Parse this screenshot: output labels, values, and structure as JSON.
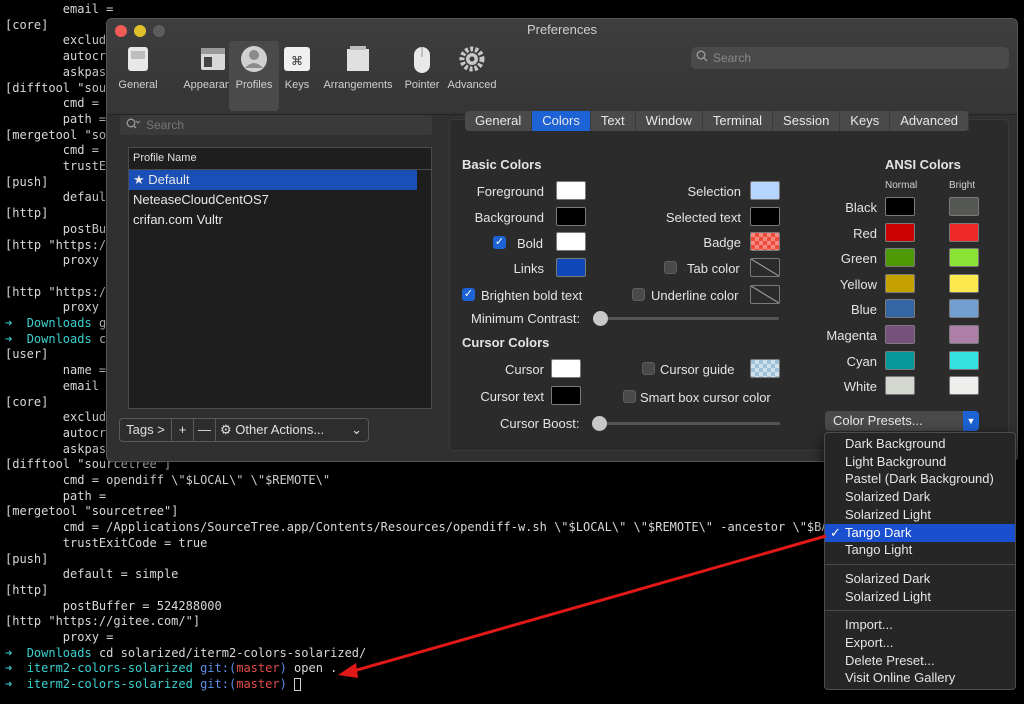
{
  "terminal": {
    "top_lines": [
      "        email = ",
      "[core]",
      "        exclude",
      "        autocrl",
      "        askpass",
      "[difftool \"sour",
      "        cmd = c",
      "        path = ",
      "[mergetool \"sou",
      "        cmd = /",
      "        trustEx",
      "[push]",
      "        default",
      "[http]",
      "        postBuf",
      "[http \"https://",
      "        proxy = ",
      "",
      "[http \"https://",
      "        proxy = "
    ],
    "prompt_lines": [
      {
        "arrow": "➜",
        "dir": "Downloads",
        "rest": " gi"
      },
      {
        "arrow": "➜",
        "dir": "Downloads",
        "rest": " ca"
      }
    ],
    "mid_lines": [
      "[user]",
      "        name = ",
      "        email = ",
      "[core]",
      "        exclude",
      "        autocrl",
      "        askpass"
    ],
    "bottom_lines": [
      "[difftool \"sourcetree\"]",
      "        cmd = opendiff \\\"$LOCAL\\\" \\\"$REMOTE\\\"",
      "        path = ",
      "[mergetool \"sourcetree\"]",
      "        cmd = /Applications/SourceTree.app/Contents/Resources/opendiff-w.sh \\\"$LOCAL\\\" \\\"$REMOTE\\\" -ancestor \\\"$BASE\\\" -",
      "        trustExitCode = true",
      "[push]",
      "        default = simple",
      "[http]",
      "        postBuffer = 524288000",
      "[http \"https://gitee.com/\"]",
      "        proxy = "
    ],
    "cmd_line": {
      "arrow": "➜",
      "dir": "Downloads",
      "cmd": " cd solarized/iterm2-colors-solarized/"
    },
    "git_lines": [
      {
        "arrow": "➜",
        "dir": "iterm2-colors-solarized",
        "git": " git:(",
        "branch": "master",
        "close": ")",
        "cmd": " open ."
      },
      {
        "arrow": "➜",
        "dir": "iterm2-colors-solarized",
        "git": " git:(",
        "branch": "master",
        "close": ")",
        "cmd": " "
      }
    ]
  },
  "prefs": {
    "title": "Preferences",
    "toolbar": [
      "General",
      "Appearance",
      "Profiles",
      "Keys",
      "Arrangements",
      "Pointer",
      "Advanced"
    ],
    "search_placeholder": "Search",
    "profile_search_placeholder": "Search",
    "profile_header": "Profile Name",
    "profiles": [
      "★ Default",
      "NeteaseCloudCentOS7",
      "crifan.com Vultr"
    ],
    "tags_label": "Tags >",
    "plus": "+",
    "minus": "—",
    "other_actions": "Other Actions...",
    "tabs": [
      "General",
      "Colors",
      "Text",
      "Window",
      "Terminal",
      "Session",
      "Keys",
      "Advanced"
    ],
    "basic_colors": "Basic Colors",
    "foreground": "Foreground",
    "background": "Background",
    "bold": "Bold",
    "links": "Links",
    "selection": "Selection",
    "selected_text": "Selected text",
    "badge": "Badge",
    "tab_color": "Tab color",
    "underline_color": "Underline color",
    "brighten": "Brighten bold text",
    "min_contrast": "Minimum Contrast:",
    "cursor_colors": "Cursor Colors",
    "cursor": "Cursor",
    "cursor_text": "Cursor text",
    "cursor_guide": "Cursor guide",
    "smart_box": "Smart box cursor color",
    "cursor_boost": "Cursor Boost:",
    "ansi_title": "ANSI Colors",
    "normal": "Normal",
    "bright": "Bright",
    "ansi": [
      {
        "name": "Black",
        "normal": "#000000",
        "bright": "#555753"
      },
      {
        "name": "Red",
        "normal": "#cc0000",
        "bright": "#ef2929"
      },
      {
        "name": "Green",
        "normal": "#4e9a06",
        "bright": "#8ae234"
      },
      {
        "name": "Yellow",
        "normal": "#c4a000",
        "bright": "#fce94f"
      },
      {
        "name": "Blue",
        "normal": "#3465a4",
        "bright": "#729fcf"
      },
      {
        "name": "Magenta",
        "normal": "#75507b",
        "bright": "#ad7fa8"
      },
      {
        "name": "Cyan",
        "normal": "#06989a",
        "bright": "#34e2e2"
      },
      {
        "name": "White",
        "normal": "#d3d7cf",
        "bright": "#eeeeec"
      }
    ],
    "color_presets": "Color Presets...",
    "swatches": {
      "foreground": "#ffffff",
      "background": "#000000",
      "bold": "#ffffff",
      "links": "#0d47b8",
      "selection": "#b5d5ff",
      "selected_text": "#000000",
      "badge": "#f04a3c",
      "cursor": "#ffffff",
      "cursor_text": "#000000"
    }
  },
  "menu": {
    "group1": [
      "Dark Background",
      "Light Background",
      "Pastel (Dark Background)",
      "Solarized Dark",
      "Solarized Light",
      "Tango Dark",
      "Tango Light"
    ],
    "checked": "✓",
    "group2": [
      "Solarized Dark",
      "Solarized Light"
    ],
    "group3": [
      "Import...",
      "Export...",
      "Delete Preset...",
      "Visit Online Gallery"
    ]
  }
}
